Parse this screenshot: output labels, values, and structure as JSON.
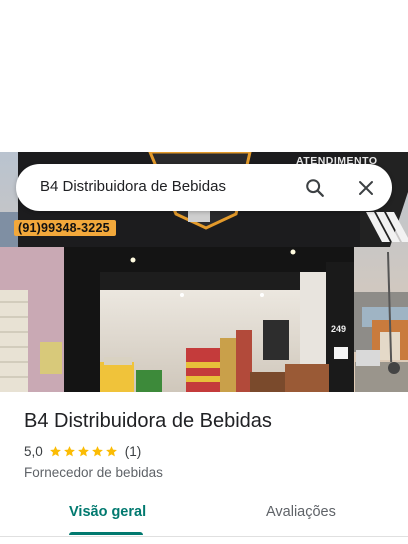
{
  "search": {
    "query": "B4 Distribuidora de Bebidas",
    "search_icon": "search-icon",
    "close_icon": "close-icon"
  },
  "photo": {
    "phone_sign": "(91)99348-3225",
    "right_sign": "ATENDIMENTO",
    "door_number": "249"
  },
  "place": {
    "name": "B4 Distribuidora de Bebidas",
    "rating": "5,0",
    "stars_filled": 5,
    "review_count": "(1)",
    "category": "Fornecedor de bebidas"
  },
  "tabs": {
    "items": [
      {
        "label": "Visão geral",
        "selected": true
      },
      {
        "label": "Avaliações",
        "selected": false
      }
    ]
  },
  "colors": {
    "accent": "#01796f",
    "star": "#fbbc04"
  }
}
